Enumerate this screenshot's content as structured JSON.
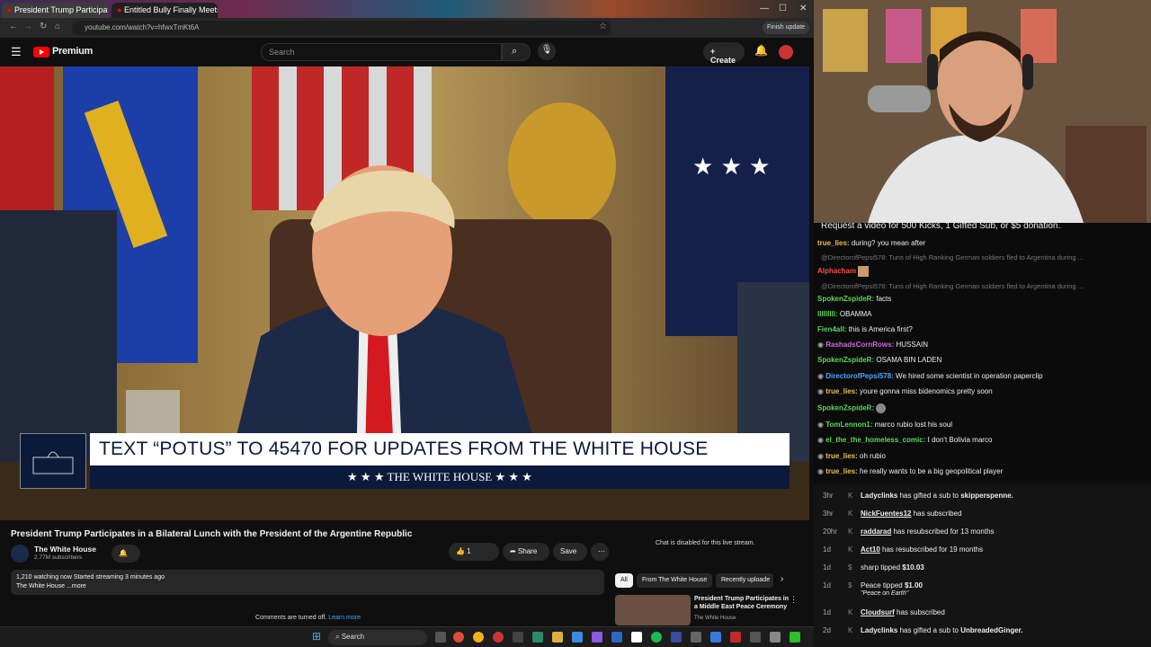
{
  "browser": {
    "tabs": [
      {
        "label": "President Trump Participat"
      },
      {
        "label": "Entitled Bully Finally Meets Ka"
      }
    ],
    "url": "youtube.com/watch?v=hfwxTmKt6A",
    "finish_update": "Finish update"
  },
  "youtube": {
    "logo": "Premium",
    "search_placeholder": "Search",
    "create_label": "Create",
    "banner": {
      "headline": "TEXT “POTUS” TO 45470 FOR UPDATES FROM THE WHITE HOUSE",
      "subline": "★ ★ ★   THE WHITE HOUSE   ★ ★ ★"
    },
    "video_title": "President Trump Participates in a Bilateral Lunch with the President of the Argentine Republic",
    "channel": {
      "name": "The White House",
      "subs": "2.77M subscribers"
    },
    "actions": {
      "likes": "1",
      "share": "Share",
      "save": "Save"
    },
    "description": {
      "line1": "1,210 watching now  Started streaming 3 minutes ago",
      "line2": "The White House ...more"
    },
    "comments": {
      "text": "Comments are turned off.",
      "link": "Learn more"
    },
    "chat_disabled": "Chat is disabled for this live stream.",
    "filters": [
      "All",
      "From The White House",
      "Recently uploade"
    ],
    "recommended": {
      "title": "President Trump Participates in a Middle East Peace Ceremony",
      "channel": "The White House"
    }
  },
  "chat": {
    "header": "Request a video for 500 Kicks, 1 Gifted Sub, or $5 donation.",
    "messages": [
      {
        "user": "true_lies:",
        "text": "during? you mean after",
        "color": "#e8c04a"
      },
      {
        "reply": "@DirectorofPepsi578: Tuns of High Ranking German soldiers fled to Argentina during ..."
      },
      {
        "user": "Alphacham",
        "text": "",
        "color": "#ff4a4a"
      },
      {
        "reply": "@DirectorofPepsi578: Tuns of High Ranking German soldiers fled to Argentina during ..."
      },
      {
        "user": "SpokenZspideR:",
        "text": "facts",
        "color": "#5ad65a"
      },
      {
        "user": "lllllllll:",
        "text": "OBAMMA",
        "color": "#5ad65a"
      },
      {
        "user": "Fien4all:",
        "text": "this is America first?",
        "color": "#5ad65a"
      },
      {
        "user": "RashadsCornRows:",
        "text": "HUSSAIN",
        "color": "#d067e0"
      },
      {
        "user": "SpokenZspideR:",
        "text": "OSAMA BIN LADEN",
        "color": "#5ad65a"
      },
      {
        "user": "DirectorofPepsi578:",
        "text": "We hired some scientist in operation paperclip",
        "color": "#4aa3ff"
      },
      {
        "user": "true_lies:",
        "text": "youre gonna miss bidenomics pretty soon",
        "color": "#e8c04a"
      },
      {
        "user": "SpokenZspideR:",
        "text": "",
        "color": "#5ad65a"
      },
      {
        "user": "TomLennon1:",
        "text": "marco rubio lost his soul",
        "color": "#5ad65a"
      },
      {
        "user": "el_the_the_homeless_comic:",
        "text": "I don't Bolivia marco",
        "color": "#5ad65a"
      },
      {
        "user": "true_lies:",
        "text": "oh rubio",
        "color": "#e8c04a"
      },
      {
        "user": "true_lies:",
        "text": "he really wants to be a big geopolitical player",
        "color": "#e8c04a"
      }
    ]
  },
  "events": [
    {
      "time": "3hr",
      "name": "Ladyclinks",
      "text": "has gifted a sub to",
      "target": "skipperspenne."
    },
    {
      "time": "3hr",
      "name": "NickFuentes12",
      "text": "has subscribed",
      "target": ""
    },
    {
      "time": "20hr",
      "name": "raddarad",
      "text": "has resubscribed for 13 months",
      "target": ""
    },
    {
      "time": "1d",
      "name": "Act10",
      "text": "has resubscribed for 19 months",
      "target": ""
    },
    {
      "time": "1d",
      "name": "sharp",
      "text": "tipped",
      "target": "$10.03"
    },
    {
      "time": "1d",
      "name": "Peace",
      "text": "tipped",
      "target": "$1.00",
      "note": "\"Peace on Earth\""
    },
    {
      "time": "1d",
      "name": "Cloudsurf",
      "text": "has subscribed",
      "target": ""
    },
    {
      "time": "2d",
      "name": "Ladyclinks",
      "text": "has gifted a sub to",
      "target": "UnbreadedGinger."
    }
  ],
  "taskbar": {
    "search": "Search"
  }
}
